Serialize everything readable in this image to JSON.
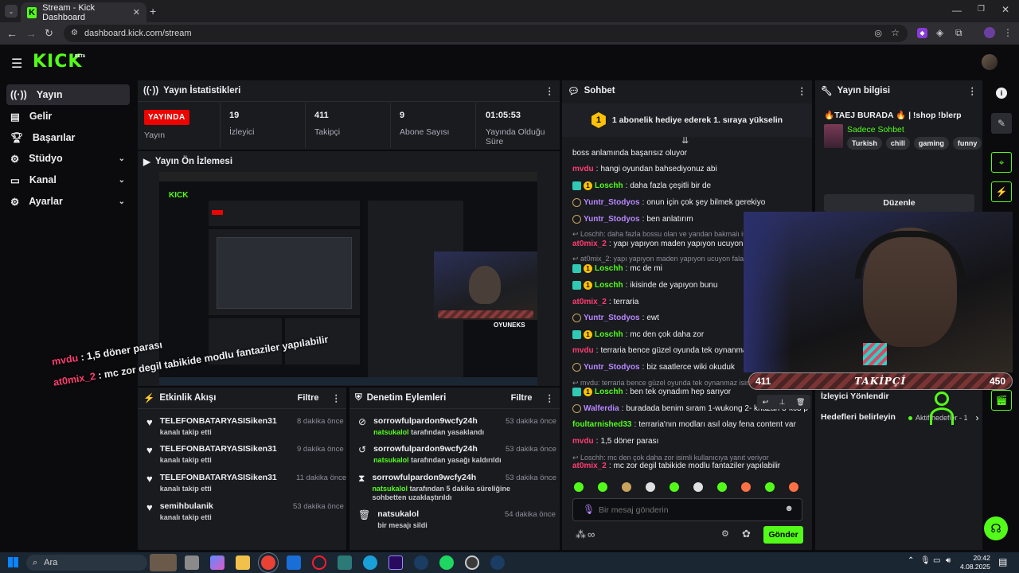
{
  "browser": {
    "tab_title": "Stream - Kick Dashboard",
    "url": "dashboard.kick.com/stream"
  },
  "kick": {
    "logo": "KICK",
    "beta": "BETA"
  },
  "sidebar": {
    "items": [
      {
        "label": "Yayın",
        "icon": "broadcast-icon"
      },
      {
        "label": "Gelir",
        "icon": "revenue-icon"
      },
      {
        "label": "Başarılar",
        "icon": "trophy-icon"
      },
      {
        "label": "Stüdyo",
        "icon": "studio-icon"
      },
      {
        "label": "Kanal",
        "icon": "channel-icon"
      },
      {
        "label": "Ayarlar",
        "icon": "gear-icon"
      }
    ]
  },
  "stats": {
    "title": "Yayın İstatistikleri",
    "live_badge": "YAYINDA",
    "live_label": "Yayın",
    "viewers": "19",
    "viewers_label": "İzleyici",
    "followers": "411",
    "followers_label": "Takipçi",
    "subs": "9",
    "subs_label": "Abone Sayısı",
    "duration": "01:05:53",
    "duration_label": "Yayında Olduğu Süre"
  },
  "preview": {
    "title": "Yayın Ön İzlemesi",
    "overlay_line1_user": "mvdu",
    "overlay_line1_text": " : 1,5 döner parası",
    "overlay_line2_user": "at0mix_2",
    "overlay_line2_text": " : mc zor degil tabikide modlu fantaziler yapılabilir"
  },
  "activity": {
    "title": "Etkinlik Akışı",
    "filter": "Filtre",
    "items": [
      {
        "user": "TELEFONBATARYASISiken31",
        "action": "kanalı takip etti",
        "time": "8 dakika önce"
      },
      {
        "user": "TELEFONBATARYASISiken31",
        "action": "kanalı takip etti",
        "time": "9 dakika önce"
      },
      {
        "user": "TELEFONBATARYASISiken31",
        "action": "kanalı takip etti",
        "time": "11 dakika önce"
      },
      {
        "user": "semihbulanik",
        "action": "kanalı takip etti",
        "time": "53 dakika önce"
      }
    ]
  },
  "moderation": {
    "title": "Denetim Eylemleri",
    "filter": "Filtre",
    "items": [
      {
        "user": "sorrowfulpardon9wcfy24h",
        "mod": "natsukalol",
        "action": " tarafından yasaklandı",
        "time": "53 dakika önce"
      },
      {
        "user": "sorrowfulpardon9wcfy24h",
        "mod": "natsukalol",
        "action": " tarafından yasağı kaldırıldı",
        "time": "53 dakika önce"
      },
      {
        "user": "sorrowfulpardon9wcfy24h",
        "mod": "natsukalol",
        "action": " tarafından 5 dakika süreliğine sohbetten uzaklaştırıldı",
        "time": "53 dakika önce"
      },
      {
        "user": "natsukalol",
        "mod": "",
        "action": "bir mesajı sildi",
        "time": "54 dakika önce"
      }
    ]
  },
  "chat": {
    "title": "Sohbet",
    "pinned_text": "1 abonelik hediye ederek 1. sıraya yükselin",
    "pinned_count": "1",
    "lines": [
      {
        "type": "msg",
        "user": "",
        "color": "#efeff1",
        "text": "boss anlamında başarısız oluyor",
        "badges": []
      },
      {
        "type": "msg",
        "user": "mvdu",
        "color": "#ff3d71",
        "text": "hangi oyundan bahsediyonuz abi",
        "badges": []
      },
      {
        "type": "msg",
        "user": "Loschh",
        "color": "#53fc18",
        "text": "daha fazla çeşitli bir de",
        "badges": [
          "sub",
          "coin"
        ]
      },
      {
        "type": "msg",
        "user": "Yuntr_Stodyos",
        "color": "#b987ff",
        "text": "onun için çok şey bilmek gerekiyo",
        "badges": [
          "og"
        ]
      },
      {
        "type": "msg",
        "user": "Yuntr_Stodyos",
        "color": "#b987ff",
        "text": "ben anlatırım",
        "badges": [
          "og"
        ]
      },
      {
        "type": "reply",
        "text": "↩ Loschh: daha fazla bossu olan ve yandan bakmalı isim"
      },
      {
        "type": "msg",
        "user": "at0mix_2",
        "color": "#ff3d71",
        "text": "yapı yapıyon maden yapıyon ucuyon falan",
        "badges": []
      },
      {
        "type": "reply",
        "text": "↩ at0mix_2: yapı yapıyon maden yapıyon ucuyon falan"
      },
      {
        "type": "msg",
        "user": "Loschh",
        "color": "#53fc18",
        "text": "mc de mi",
        "badges": [
          "sub",
          "coin"
        ]
      },
      {
        "type": "msg",
        "user": "Loschh",
        "color": "#53fc18",
        "text": "ikisinde de yapıyon bunu",
        "badges": [
          "sub",
          "coin"
        ]
      },
      {
        "type": "msg",
        "user": "at0mix_2",
        "color": "#ff3d71",
        "text": "terraria",
        "badges": []
      },
      {
        "type": "msg",
        "user": "Yuntr_Stodyos",
        "color": "#b987ff",
        "text": "ewt",
        "badges": [
          "og"
        ]
      },
      {
        "type": "msg",
        "user": "Loschh",
        "color": "#53fc18",
        "text": "mc den çok daha zor",
        "badges": [
          "sub",
          "coin"
        ]
      },
      {
        "type": "msg",
        "user": "mvdu",
        "color": "#ff3d71",
        "text": "terraria bence güzel oyunda tek oynanmaz",
        "badges": []
      },
      {
        "type": "msg",
        "user": "Yuntr_Stodyos",
        "color": "#b987ff",
        "text": "biz saatlerce wiki okuduk",
        "badges": [
          "og"
        ]
      },
      {
        "type": "reply",
        "text": "↩ mvdu: terraria bence güzel oyunda tek oynanmaz isimli"
      },
      {
        "type": "msg",
        "user": "Loschh",
        "color": "#53fc18",
        "text": "ben tek oynadım hep sarıyor",
        "badges": [
          "sub",
          "coin"
        ]
      },
      {
        "type": "msg",
        "user": "Walferdia",
        "color": "#b987ff",
        "text": "buradada benim sıram 1-wukong 2- khazan 3-kc3 p",
        "badges": [
          "og"
        ]
      },
      {
        "type": "msg",
        "user": "foultarnished33",
        "color": "#53fc18",
        "text": "terraria'nın modları asıl olay fena content var",
        "badges": []
      },
      {
        "type": "msg",
        "user": "mvdu",
        "color": "#ff3d71",
        "text": "1,5 döner parası",
        "badges": []
      },
      {
        "type": "reply",
        "text": "↩ Loschh: mc den çok daha zor isimli kullanıcıya yanıt veriyor"
      },
      {
        "type": "msg",
        "user": "at0mix_2",
        "color": "#ff3d71",
        "text": "mc zor degil tabikide modlu fantaziler yapılabilir",
        "badges": []
      }
    ],
    "input_placeholder": "Bir mesaj gönderin",
    "send_label": "Gönder",
    "points": "∞"
  },
  "info": {
    "title": "Yayın bilgisi",
    "stream_title": "🔥TAEJ BURADA 🔥 | !shop !blerp",
    "category": "Sadece Sohbet",
    "tags": [
      "Turkish",
      "chill",
      "gaming",
      "funny"
    ],
    "edit_label": "Düzenle",
    "viewer_directed": "İzleyici Yönlendir",
    "goals_label": "Hedefleri belirleyin",
    "goals_status": "Aktif hedefler - 1"
  },
  "overlay": {
    "followers_now": "411",
    "follow_label": "TAKİPÇİ",
    "follow_goal": "450",
    "brand": "OYUNEKS"
  },
  "taskbar": {
    "search": "Ara",
    "time": "20:42",
    "date": "4.08.2025"
  },
  "colors": {
    "accent": "#53fc18",
    "live": "#eb0400",
    "panel": "#191b1f"
  }
}
